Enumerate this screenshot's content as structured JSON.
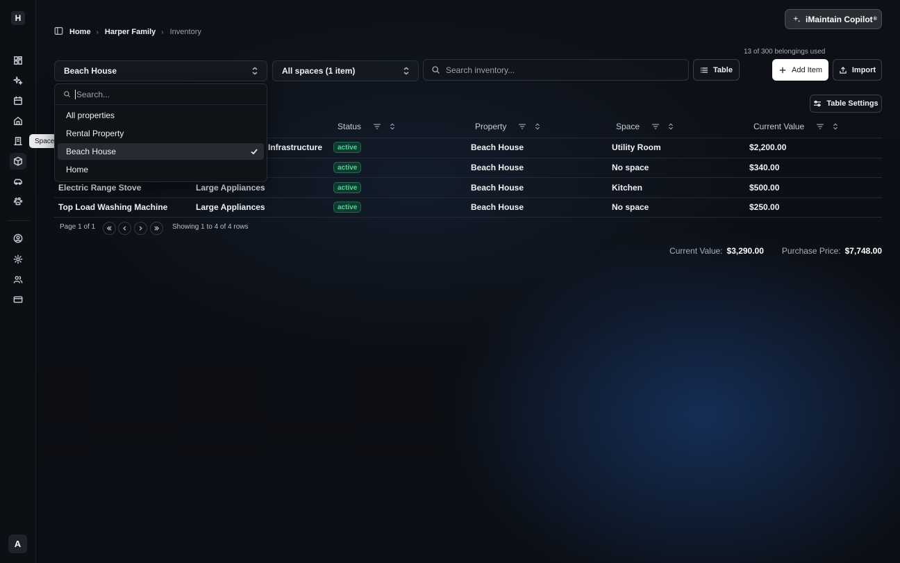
{
  "sidebar": {
    "logo": "H",
    "tooltip": "Spaces",
    "avatar": "A",
    "icons": [
      "dashboard-icon",
      "sparkles-icon",
      "calendar-icon",
      "home-icon",
      "building-icon",
      "box-icon",
      "car-icon",
      "paw-icon",
      "user-circle-icon",
      "settings-icon",
      "users-icon",
      "credit-card-icon"
    ]
  },
  "breadcrumb": {
    "items": [
      "Home",
      "Harper Family",
      "Inventory"
    ]
  },
  "copilot": {
    "label": "iMaintain Copilot",
    "mark": "®"
  },
  "usage": "13 of 300 belongings used",
  "filters": {
    "property": "Beach House",
    "space": "All spaces (1 item)",
    "search_placeholder": "Search inventory...",
    "view_label": "Table"
  },
  "actions": {
    "add_label": "Add Item",
    "import_label": "Import",
    "table_settings_label": "Table Settings"
  },
  "dropdown": {
    "search_placeholder": "Search...",
    "options": [
      "All properties",
      "Rental Property",
      "Beach House",
      "Home"
    ],
    "selected": "Beach House"
  },
  "table": {
    "columns": [
      "Status",
      "Property",
      "Space",
      "Current Value"
    ],
    "rows": [
      {
        "name": "",
        "category": "Infrastructure",
        "status": "active",
        "property": "Beach House",
        "space": "Utility Room",
        "value": "$2,200.00"
      },
      {
        "name": "",
        "category": "",
        "status": "active",
        "property": "Beach House",
        "space": "No space",
        "value": "$340.00"
      },
      {
        "name": "Electric Range Stove",
        "category": "Large Appliances",
        "status": "active",
        "property": "Beach House",
        "space": "Kitchen",
        "value": "$500.00"
      },
      {
        "name": "Top Load Washing Machine",
        "category": "Large Appliances",
        "status": "active",
        "property": "Beach House",
        "space": "No space",
        "value": "$250.00"
      }
    ]
  },
  "pagination": {
    "page_label": "Page 1 of 1",
    "showing_label": "Showing 1 to 4 of 4 rows"
  },
  "totals": {
    "current_label": "Current Value:",
    "current_value": "$3,290.00",
    "purchase_label": "Purchase Price:",
    "purchase_value": "$7,748.00"
  },
  "colors": {
    "background": "#0b0d12",
    "accent_glow": "#1c488c",
    "badge_text": "#52d3a0",
    "badge_bg": "#0f3a2d"
  }
}
